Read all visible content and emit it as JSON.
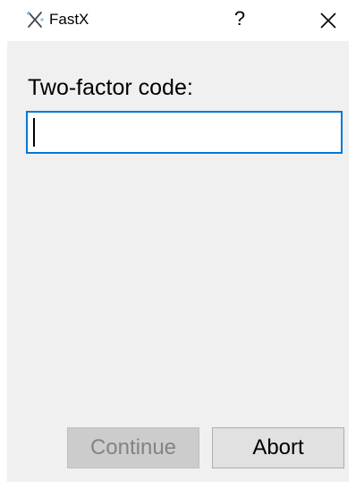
{
  "titlebar": {
    "app_title": "FastX",
    "app_icon": "fastx-logo-icon",
    "help_label": "?",
    "close_icon": "close-icon"
  },
  "dialog": {
    "field_label": "Two-factor code:",
    "field_value": "",
    "field_focused": true,
    "continue_label": "Continue",
    "continue_enabled": false,
    "abort_label": "Abort"
  },
  "colors": {
    "client_background": "#f0f0f0",
    "focus_border": "#0078d7",
    "disabled_text": "#838383",
    "button_face": "#e1e1e1"
  }
}
